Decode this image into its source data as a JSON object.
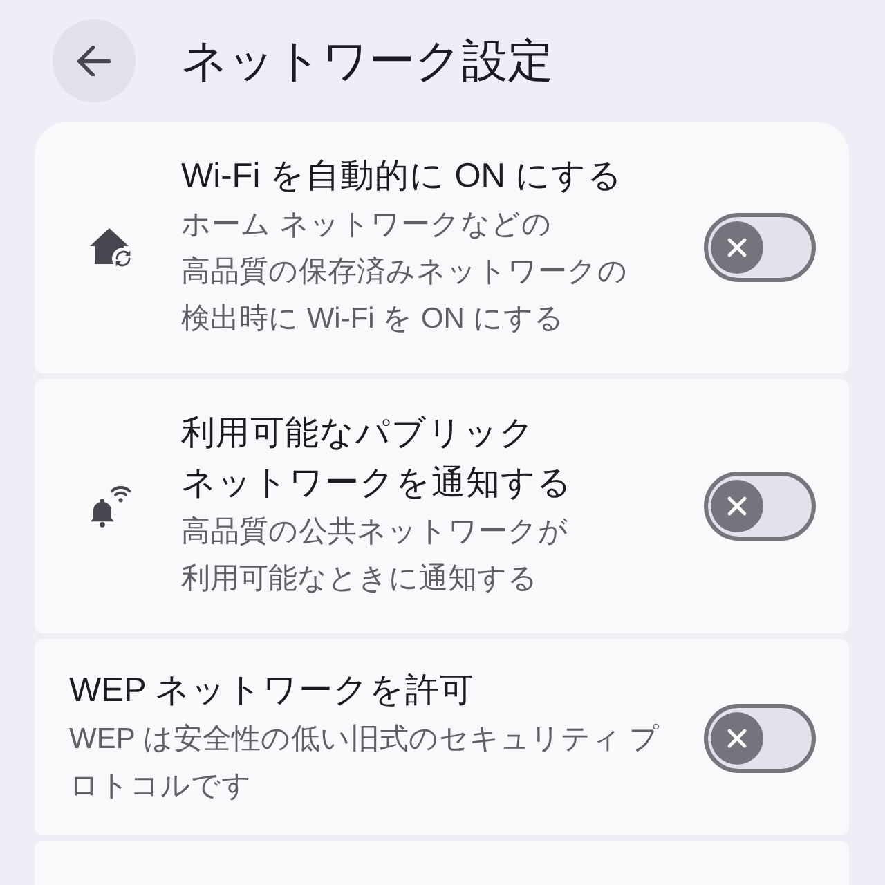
{
  "header": {
    "title": "ネットワーク設定"
  },
  "settings": [
    {
      "kind": "house",
      "title": "Wi-Fi を自動的に ON にする",
      "description": "ホーム ネットワークなどの高品質の保存済みネットワークの検出時に Wi-Fi を ON にする",
      "on": false
    },
    {
      "kind": "bell",
      "title": "利用可能なパブリックネットワークを通知する",
      "description": "高品質の公共ネットワークが利用可能なときに通知する",
      "on": false
    },
    {
      "kind": "plain",
      "title": "WEP ネットワークを許可",
      "description": "WEP は安全性の低い旧式のセキュリティ プロトコルです",
      "on": false
    }
  ]
}
